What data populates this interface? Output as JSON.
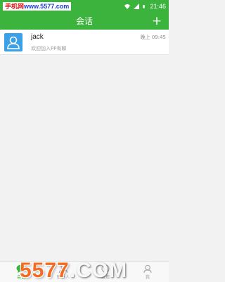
{
  "status_bar": {
    "watermark_prefix": "手机网",
    "watermark_url": "www.5577.com",
    "time": "21:46"
  },
  "header": {
    "title": "会话",
    "add_label": "+"
  },
  "conversations": [
    {
      "name": "jack",
      "time": "晚上 09:45",
      "preview": "欢迎加入PP有聊"
    }
  ],
  "tabs": [
    {
      "label": "会话",
      "icon": "chat-bubble-icon",
      "active": true
    },
    {
      "label": "联系人",
      "icon": "contacts-icon",
      "active": false
    },
    {
      "label": "发现",
      "icon": "discover-icon",
      "active": false
    },
    {
      "label": "我",
      "icon": "profile-icon",
      "active": false
    }
  ],
  "watermark_bottom": {
    "main": "5577",
    "suffix": ".COM"
  },
  "colors": {
    "brand_green": "#3cb33c",
    "avatar_blue": "#3aa0e8",
    "background": "#f2f2f2"
  }
}
